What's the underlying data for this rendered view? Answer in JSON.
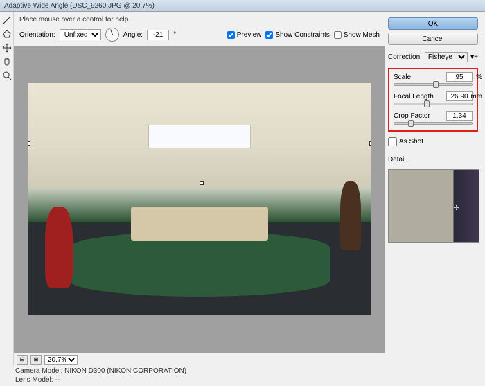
{
  "title": "Adaptive Wide Angle (DSC_9260.JPG @ 20.7%)",
  "help": "Place mouse over a control for help",
  "options": {
    "orientation_label": "Orientation:",
    "orientation_value": "Unfixed",
    "angle_label": "Angle:",
    "angle_value": "-21",
    "preview_label": "Preview",
    "preview_checked": true,
    "constraints_label": "Show Constraints",
    "constraints_checked": true,
    "mesh_label": "Show Mesh",
    "mesh_checked": false
  },
  "status": {
    "zoom": "20.7%"
  },
  "info": {
    "camera_label": "Camera Model: ",
    "camera_value": "NIKON D300 (NIKON CORPORATION)",
    "lens_label": "Lens Model: ",
    "lens_value": "--"
  },
  "buttons": {
    "ok": "OK",
    "cancel": "Cancel"
  },
  "correction": {
    "label": "Correction:",
    "value": "Fisheye"
  },
  "sliders": {
    "scale": {
      "label": "Scale",
      "value": "95",
      "unit": "%",
      "pos": 50
    },
    "focal": {
      "label": "Focal Length",
      "value": "26.90",
      "unit": "mm",
      "pos": 38
    },
    "crop": {
      "label": "Crop Factor",
      "value": "1.34",
      "pos": 18
    }
  },
  "as_shot_label": "As Shot",
  "detail_label": "Detail"
}
